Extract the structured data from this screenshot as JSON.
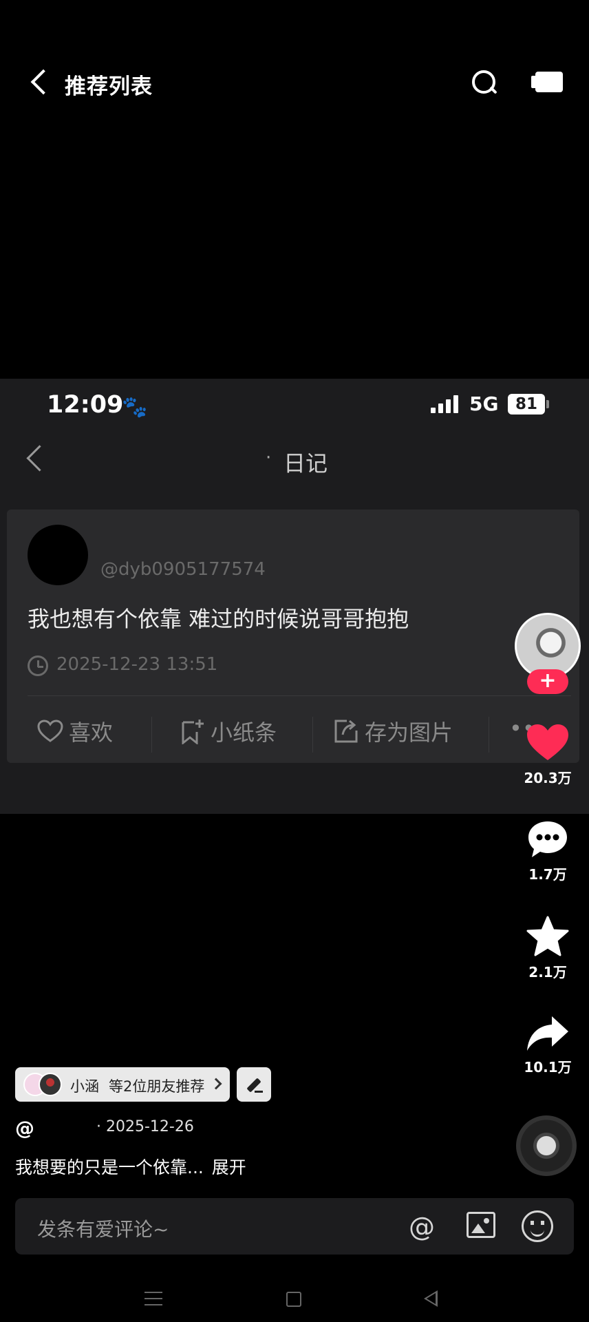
{
  "topbar": {
    "title": "推荐列表",
    "icons": [
      "back-icon",
      "search-icon",
      "screen-icon"
    ]
  },
  "embedded": {
    "status": {
      "time": "12:09",
      "network": "5G",
      "battery": "81"
    },
    "diary": {
      "dot": "·",
      "title": "日记"
    },
    "card": {
      "handle": "@dyb0905177574",
      "text": "我也想有个依靠 难过的时候说哥哥抱抱",
      "date": "2025-12-23 13:51",
      "actions": {
        "like": "喜欢",
        "note": "小纸条",
        "save_image": "存为图片"
      }
    }
  },
  "rail": {
    "follow": "+",
    "likes": "20.3万",
    "comments": "1.7万",
    "favorites": "2.1万",
    "shares": "10.1万"
  },
  "friends": {
    "name": "小涵",
    "text": "等2位朋友推荐"
  },
  "post": {
    "at": "@",
    "meta": "· 2025-12-26",
    "caption": "我想要的只是一个依靠...",
    "more": "展开"
  },
  "comment": {
    "placeholder": "发条有爱评论~",
    "at": "@"
  },
  "colors": {
    "accent": "#fe2c55",
    "background": "#000000",
    "panel": "#1c1c1e"
  }
}
